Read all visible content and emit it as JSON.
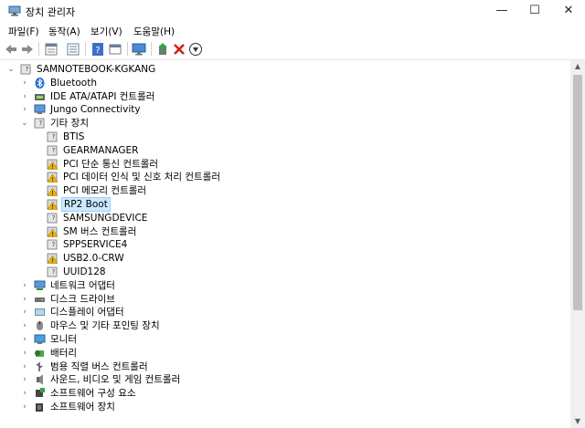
{
  "window": {
    "title": "장치 관리자",
    "minimize": "—",
    "maximize": "☐",
    "close": "✕"
  },
  "menu": [
    "파일(F)",
    "동작(A)",
    "보기(V)",
    "도움말(H)"
  ],
  "toolbar": [
    "back-icon",
    "forward-icon",
    "properties-icon",
    "list-icon",
    "help-icon",
    "update-driver-icon",
    "monitor-icon",
    "add-driver-icon",
    "uninstall-icon",
    "download-icon"
  ],
  "tree": {
    "root": "SAMNOTEBOOK-KGKANG",
    "items": [
      {
        "label": "Bluetooth",
        "icon": "bluetooth-icon",
        "expanded": false
      },
      {
        "label": "IDE ATA/ATAPI 컨트롤러",
        "icon": "ide-controller-icon",
        "expanded": false
      },
      {
        "label": "Jungo Connectivity",
        "icon": "monitor-device-icon",
        "expanded": false
      },
      {
        "label": "기타 장치",
        "icon": "unknown-device-icon",
        "expanded": true
      },
      {
        "label": "BTIS",
        "icon": "unknown-device-icon",
        "child": true
      },
      {
        "label": "GEARMANAGER",
        "icon": "unknown-device-icon",
        "child": true
      },
      {
        "label": "PCI 단순 통신 컨트롤러",
        "icon": "warning-device-icon",
        "child": true
      },
      {
        "label": "PCI 데이터 인식 및 신호 처리 컨트롤러",
        "icon": "warning-device-icon",
        "child": true
      },
      {
        "label": "PCI 메모리 컨트롤러",
        "icon": "warning-device-icon",
        "child": true
      },
      {
        "label": "RP2 Boot",
        "icon": "warning-device-icon",
        "child": true,
        "selected": true
      },
      {
        "label": "SAMSUNGDEVICE",
        "icon": "unknown-device-icon",
        "child": true
      },
      {
        "label": "SM 버스 컨트롤러",
        "icon": "warning-device-icon",
        "child": true
      },
      {
        "label": "SPPSERVICE4",
        "icon": "unknown-device-icon",
        "child": true
      },
      {
        "label": "USB2.0-CRW",
        "icon": "warning-device-icon",
        "child": true
      },
      {
        "label": "UUID128",
        "icon": "unknown-device-icon",
        "child": true
      },
      {
        "label": "네트워크 어댑터",
        "icon": "network-adapter-icon",
        "expanded": false
      },
      {
        "label": "디스크 드라이브",
        "icon": "disk-drive-icon",
        "expanded": false
      },
      {
        "label": "디스플레이 어댑터",
        "icon": "display-adapter-icon",
        "expanded": false
      },
      {
        "label": "마우스 및 기타 포인팅 장치",
        "icon": "mouse-icon",
        "expanded": false
      },
      {
        "label": "모니터",
        "icon": "monitor-icon",
        "expanded": false
      },
      {
        "label": "배터리",
        "icon": "battery-icon",
        "expanded": false
      },
      {
        "label": "범용 직렬 버스 컨트롤러",
        "icon": "usb-controller-icon",
        "expanded": false
      },
      {
        "label": "사운드, 비디오 및 게임 컨트롤러",
        "icon": "sound-icon",
        "expanded": false
      },
      {
        "label": "소프트웨어 구성 요소",
        "icon": "software-component-icon",
        "expanded": false
      },
      {
        "label": "소프트웨어 장치",
        "icon": "software-device-icon",
        "expanded": false
      }
    ]
  },
  "colors": {
    "selection": "#cce8ff",
    "selection_border": "#99d1ff",
    "scrollbar_thumb": "#c1c1c1"
  }
}
